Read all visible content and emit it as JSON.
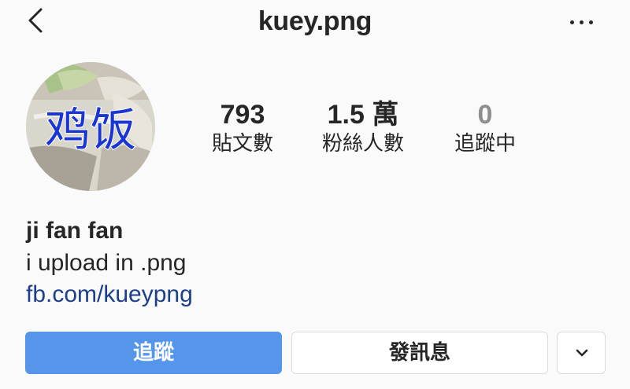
{
  "header": {
    "title": "kuey.png",
    "back_icon": "chevron-left-icon",
    "more_icon": "more-horizontal-icon"
  },
  "profile": {
    "avatar_text": "鸡饭",
    "avatar_text_color": "#1a35d6",
    "stats": [
      {
        "value": "793",
        "label": "貼文數"
      },
      {
        "value": "1.5 萬",
        "label": "粉絲人數"
      },
      {
        "value": "0",
        "label": "追蹤中"
      }
    ]
  },
  "bio": {
    "name": "ji fan fan",
    "text": "i upload in .png",
    "link": "fb.com/kueypng"
  },
  "actions": {
    "follow_label": "追蹤",
    "message_label": "發訊息",
    "dropdown_icon": "chevron-down-icon",
    "follow_color": "#5596eb"
  }
}
